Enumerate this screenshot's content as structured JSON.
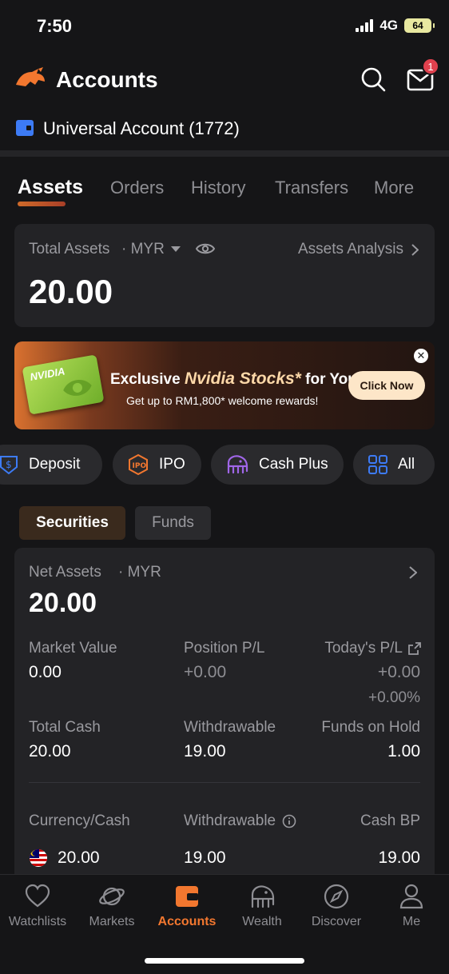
{
  "status": {
    "time": "7:50",
    "network": "4G",
    "battery": "64"
  },
  "header": {
    "title": "Accounts",
    "mail_badge": "1",
    "search_icon": "search-icon",
    "mail_icon": "mail-icon"
  },
  "account": {
    "name": "Universal Account (1772)"
  },
  "tabs": [
    {
      "label": "Assets",
      "active": true
    },
    {
      "label": "Orders"
    },
    {
      "label": "History"
    },
    {
      "label": "Transfers"
    },
    {
      "label": "More"
    }
  ],
  "total_assets": {
    "label": "Total Assets",
    "currency": "· MYR",
    "analysis_link": "Assets Analysis",
    "value": "20.00"
  },
  "banner": {
    "card_text": "NVIDIA",
    "title_prefix": "Exclusive ",
    "title_highlight": "Nvidia Stocks*",
    "title_suffix": " for You!",
    "subtitle": "Get up to RM1,800* welcome rewards!",
    "button": "Click Now"
  },
  "quick_actions": [
    {
      "label": "Deposit",
      "icon": "deposit-icon"
    },
    {
      "label": "IPO",
      "icon": "ipo-icon"
    },
    {
      "label": "Cash Plus",
      "icon": "elephant-icon"
    },
    {
      "label": "All",
      "icon": "grid-icon"
    }
  ],
  "segments": {
    "securities": "Securities",
    "funds": "Funds"
  },
  "securities": {
    "net_assets_label": "Net Assets",
    "currency": "· MYR",
    "net_assets_value": "20.00",
    "market_value_label": "Market Value",
    "market_value": "0.00",
    "position_pl_label": "Position P/L",
    "position_pl": "+0.00",
    "todays_pl_label": "Today's P/L",
    "todays_pl": "+0.00",
    "todays_pl_pct": "+0.00%",
    "total_cash_label": "Total Cash",
    "total_cash": "20.00",
    "withdrawable_label": "Withdrawable",
    "withdrawable": "19.00",
    "funds_on_hold_label": "Funds on Hold",
    "funds_on_hold": "1.00",
    "currency_cash_label": "Currency/Cash",
    "withdrawable2_label": "Withdrawable",
    "cash_bp_label": "Cash BP",
    "myr_cash": "20.00",
    "myr_withdrawable": "19.00",
    "myr_cash_bp": "19.00"
  },
  "bottom_nav": [
    {
      "label": "Watchlists",
      "icon": "heart-icon"
    },
    {
      "label": "Markets",
      "icon": "planet-icon"
    },
    {
      "label": "Accounts",
      "icon": "wallet-icon",
      "active": true
    },
    {
      "label": "Wealth",
      "icon": "elephant-icon"
    },
    {
      "label": "Discover",
      "icon": "compass-icon"
    },
    {
      "label": "Me",
      "icon": "person-icon"
    }
  ],
  "colors": {
    "accent": "#f2772f",
    "background": "#151517",
    "card": "#232326",
    "badge": "#e0414e"
  }
}
